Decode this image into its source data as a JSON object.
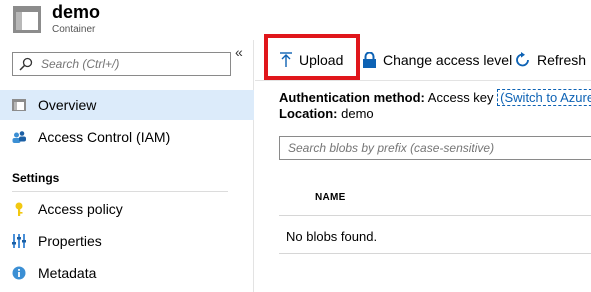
{
  "header": {
    "title": "demo",
    "subtitle": "Container",
    "icon": "container-icon"
  },
  "sidebar": {
    "search": {
      "placeholder": "Search (Ctrl+/)",
      "icon": "search-icon"
    },
    "collapse_glyph": "«",
    "items": [
      {
        "label": "Overview",
        "icon": "overview-icon",
        "active": true
      },
      {
        "label": "Access Control (IAM)",
        "icon": "iam-icon",
        "active": false
      }
    ],
    "sections": [
      {
        "title": "Settings",
        "items": [
          {
            "label": "Access policy",
            "icon": "key-icon"
          },
          {
            "label": "Properties",
            "icon": "properties-icon"
          },
          {
            "label": "Metadata",
            "icon": "info-icon"
          }
        ]
      }
    ]
  },
  "toolbar": {
    "upload_label": "Upload",
    "change_access_label": "Change access level",
    "refresh_label": "Refresh"
  },
  "main": {
    "auth_label": "Authentication method:",
    "auth_value": "Access key",
    "auth_link": "(Switch to Azure",
    "location_label": "Location:",
    "location_value": "demo",
    "blob_search_placeholder": "Search blobs by prefix (case-sensitive)",
    "columns": [
      "NAME"
    ],
    "empty_message": "No blobs found."
  },
  "colors": {
    "accent": "#0d62b4",
    "highlight": "#e0161b",
    "active_bg": "#dcebfa"
  }
}
